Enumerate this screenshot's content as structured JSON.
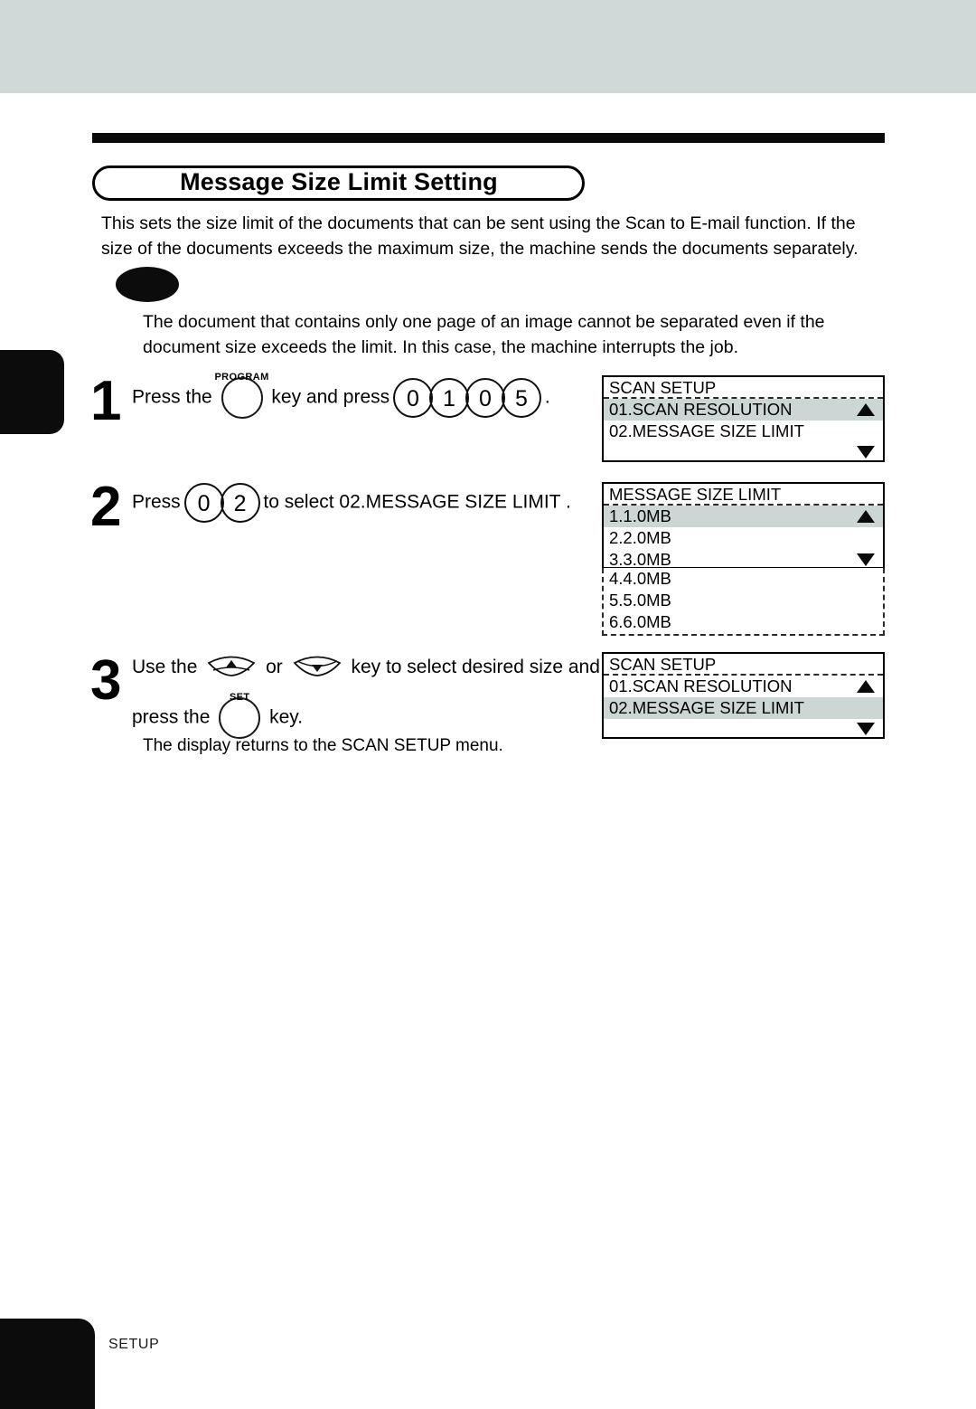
{
  "page": {
    "title": "Message Size Limit Setting",
    "footer_label": "SETUP"
  },
  "intro": {
    "paragraph": "This sets the size limit of the documents that can be sent using the Scan to E-mail function. If the size of the documents exceeds the maximum size, the machine sends the documents separately."
  },
  "note": {
    "badge_label": "",
    "body": "The document that contains only one page of an image cannot be separated even if the document size exceeds the limit.  In this case, the machine interrupts the job."
  },
  "steps": [
    {
      "number": "1",
      "text_before_key": "Press the",
      "key_cap": "PROGRAM",
      "text_after_key": "key and press",
      "digits": [
        "0",
        "1",
        "0",
        "5"
      ],
      "text_end": "."
    },
    {
      "number": "2",
      "text_before_key": "Press",
      "digits": [
        "0",
        "2"
      ],
      "text_after_key": "to select  02.MESSAGE SIZE LIMIT ."
    },
    {
      "number": "3",
      "line1_a": "Use the",
      "line1_or": "or",
      "line1_b": "key to select desired size and",
      "line2_a": "press the",
      "key_cap": "SET",
      "line2_b": "key.",
      "sub": "The display returns to the SCAN SETUP menu."
    }
  ],
  "lcd_panels": [
    {
      "name": "scan-setup-initial",
      "title": "SCAN SETUP",
      "rows": [
        {
          "label": "01.SCAN RESOLUTION",
          "selected": true,
          "arrow": "up"
        },
        {
          "label": "02.MESSAGE SIZE LIMIT",
          "selected": false,
          "arrow": ""
        },
        {
          "label": "",
          "selected": false,
          "arrow": "down"
        }
      ]
    },
    {
      "name": "message-size-limit-list",
      "title": "MESSAGE SIZE LIMIT",
      "rows": [
        {
          "label": "1.1.0MB",
          "selected": true,
          "arrow": "up"
        },
        {
          "label": "2.2.0MB",
          "selected": false,
          "arrow": ""
        },
        {
          "label": "3.3.0MB",
          "selected": false,
          "arrow": "down"
        }
      ],
      "hidden_rows": [
        {
          "label": "4.4.0MB"
        },
        {
          "label": "5.5.0MB"
        },
        {
          "label": "6.6.0MB"
        }
      ]
    },
    {
      "name": "scan-setup-returned",
      "title": "SCAN SETUP",
      "rows": [
        {
          "label": "01.SCAN RESOLUTION",
          "selected": false,
          "arrow": "up"
        },
        {
          "label": "02.MESSAGE SIZE LIMIT",
          "selected": true,
          "arrow": ""
        },
        {
          "label": "",
          "selected": false,
          "arrow": "down"
        }
      ]
    }
  ],
  "colors": {
    "band": "#d0d9d8",
    "lcd_highlight": "#ccd6d4",
    "ink": "#0a0a0a"
  }
}
